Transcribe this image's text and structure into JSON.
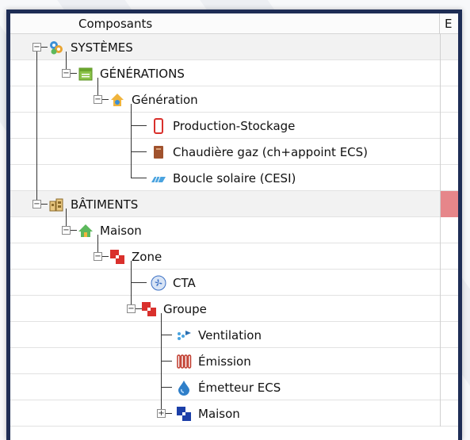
{
  "header": {
    "col_main": "Composants",
    "col_e": "E"
  },
  "tree": [
    {
      "label": "SYSTÈMES",
      "icon": "systems-gears-icon",
      "toggle": "−"
    },
    {
      "label": "GÉNÉRATIONS",
      "icon": "generations-calendar-icon",
      "toggle": "−"
    },
    {
      "label": "Génération",
      "icon": "generation-house-icon",
      "toggle": "−"
    },
    {
      "label": "Production-Stockage",
      "icon": "storage-tank-icon"
    },
    {
      "label": "Chaudière gaz (ch+appoint ECS)",
      "icon": "gas-boiler-icon"
    },
    {
      "label": "Boucle solaire (CESI)",
      "icon": "solar-panel-icon"
    },
    {
      "label": "BÂTIMENTS",
      "icon": "buildings-icon",
      "toggle": "−"
    },
    {
      "label": "Maison",
      "icon": "house-icon",
      "toggle": "−"
    },
    {
      "label": "Zone",
      "icon": "zone-blocks-icon",
      "toggle": "−"
    },
    {
      "label": "CTA",
      "icon": "fan-icon"
    },
    {
      "label": "Groupe",
      "icon": "group-blocks-icon",
      "toggle": "−"
    },
    {
      "label": "Ventilation",
      "icon": "ventilation-icon"
    },
    {
      "label": "Émission",
      "icon": "radiator-icon"
    },
    {
      "label": "Émetteur ECS",
      "icon": "water-drop-icon"
    },
    {
      "label": "Maison",
      "icon": "maison-blocks-icon",
      "toggle": "+"
    }
  ],
  "colors": {
    "frame": "#1e2d55",
    "error_cell": "#e6868a"
  }
}
